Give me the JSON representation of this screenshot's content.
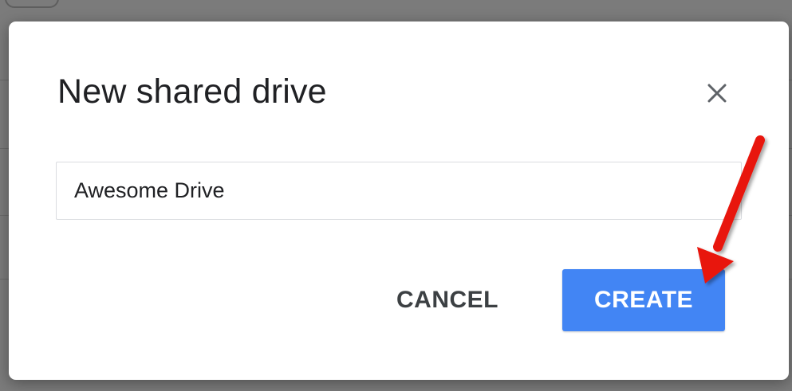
{
  "dialog": {
    "title": "New shared drive",
    "close_icon": "close-icon",
    "name_input": {
      "value": "Awesome Drive"
    },
    "cancel_label": "CANCEL",
    "create_label": "CREATE"
  },
  "annotation": {
    "icon": "red-arrow-icon",
    "color": "#e8170f"
  },
  "colors": {
    "primary": "#4285f4",
    "title_text": "#202124",
    "button_text": "#3c4043",
    "input_border": "#dadce0",
    "backdrop": "#7b7b7b"
  }
}
